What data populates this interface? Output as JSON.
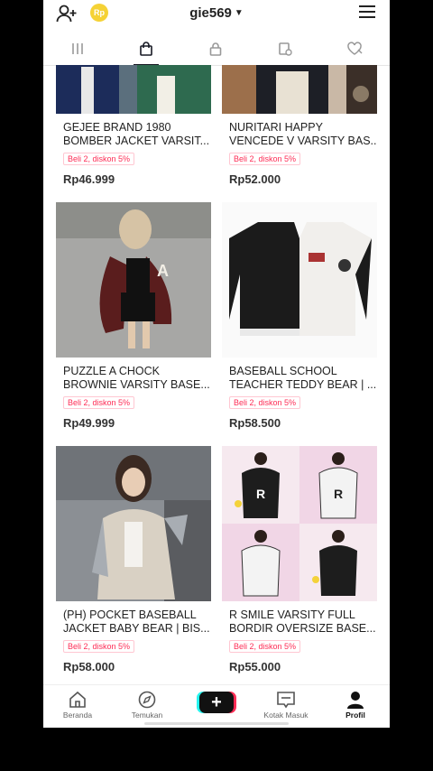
{
  "header": {
    "username": "gie569",
    "coin_label": "Rp"
  },
  "tabs": [
    {
      "icon": "grid-icon",
      "active": false
    },
    {
      "icon": "shopping-bag-icon",
      "active": true
    },
    {
      "icon": "lock-icon",
      "active": false
    },
    {
      "icon": "tagged-icon",
      "active": false
    },
    {
      "icon": "liked-icon",
      "active": false
    }
  ],
  "products": [
    {
      "title1": "GEJEE BRAND 1980",
      "title2": "BOMBER JACKET VARSIT...",
      "badge": "Beli 2, diskon 5%",
      "price": "Rp46.999"
    },
    {
      "title1": "NURITARI HAPPY",
      "title2": "VENCEDE V VARSITY BAS...",
      "badge": "Beli 2, diskon 5%",
      "price": "Rp52.000"
    },
    {
      "title1": "PUZZLE A CHOCK",
      "title2": "BROWNIE VARSITY BASE...",
      "badge": "Beli 2, diskon 5%",
      "price": "Rp49.999"
    },
    {
      "title1": "BASEBALL SCHOOL",
      "title2": "TEACHER TEDDY BEAR | ...",
      "badge": "Beli 2, diskon 5%",
      "price": "Rp58.500"
    },
    {
      "title1": "(PH) POCKET BASEBALL",
      "title2": "JACKET BABY BEAR | BIS...",
      "badge": "Beli 2, diskon 5%",
      "price": "Rp58.000"
    },
    {
      "title1": "R SMILE VARSITY FULL",
      "title2": "BORDIR OVERSIZE BASE...",
      "badge": "Beli 2, diskon 5%",
      "price": "Rp55.000"
    }
  ],
  "nav": {
    "home": "Beranda",
    "discover": "Temukan",
    "create": "+",
    "inbox": "Kotak Masuk",
    "profile": "Profil"
  },
  "colors": {
    "accent": "#fe2c55",
    "cyan": "#25f4ee",
    "coin": "#f5d235"
  }
}
